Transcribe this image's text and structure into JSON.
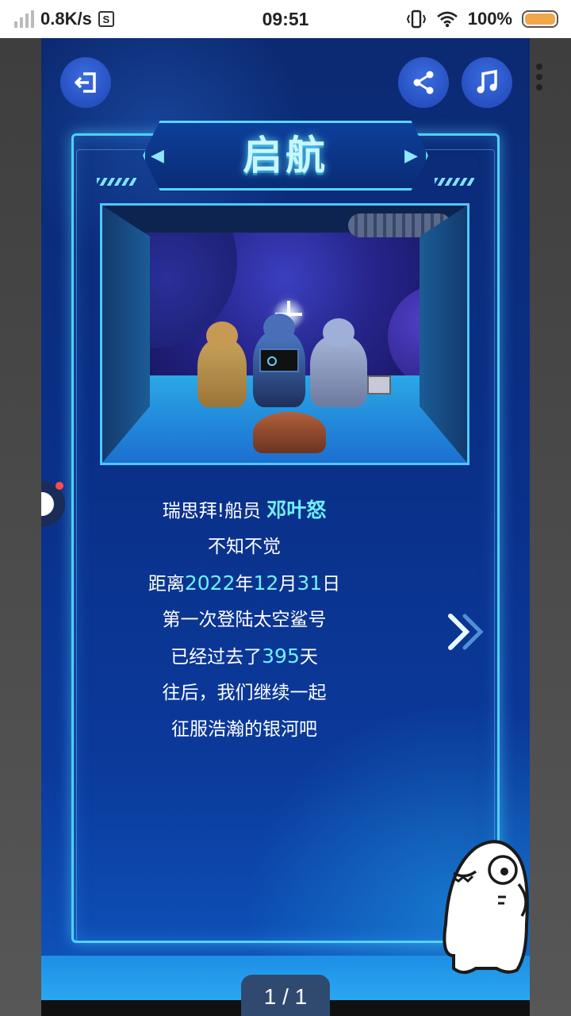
{
  "status_bar": {
    "net_speed": "0.8K/s",
    "app_badge": "S",
    "time": "09:51",
    "battery": "100%"
  },
  "card": {
    "title": "启航",
    "message": {
      "line1_prefix": "瑞思拜!船员",
      "line1_name": "邓叶怒",
      "line2": "不知不觉",
      "line3_prefix": "距离",
      "date_year": "2022",
      "year_char": "年",
      "date_month": "12",
      "month_char": "月",
      "date_day": "31",
      "day_char": "日",
      "line4": "第一次登陆太空鲨号",
      "line5_prefix": "已经过去了",
      "days": "395",
      "line5_suffix": "天",
      "line6": "往后，我们继续一起",
      "line7": "征服浩瀚的银河吧"
    }
  },
  "pager": "1 / 1",
  "icons": {
    "exit": "exit-icon",
    "share": "share-icon",
    "music": "music-icon",
    "next": "chevron-right-icon"
  },
  "colors": {
    "highlight": "#6ff0ff",
    "frame": "#4fd2ff",
    "card_bg": "#0a2f86"
  }
}
